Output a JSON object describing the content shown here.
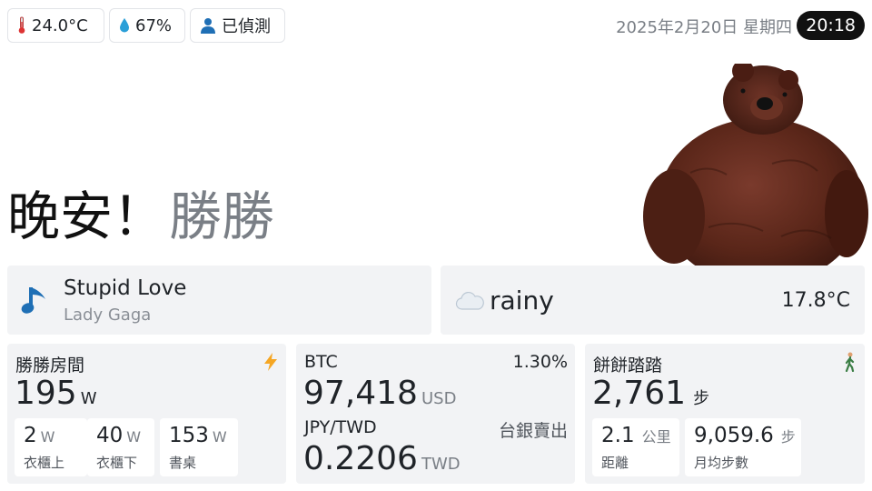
{
  "status": {
    "temperature": "24.0°C",
    "humidity": "67%",
    "presence": "已偵測"
  },
  "header": {
    "date": "2025年2月20日 星期四",
    "time": "20:18"
  },
  "greeting": {
    "hello": "晚安！",
    "name": "勝勝"
  },
  "music": {
    "title": "Stupid Love",
    "artist": "Lady Gaga",
    "icon": "music-note-icon"
  },
  "weather": {
    "condition": "rainy",
    "temperature": "17.8°C",
    "icon": "cloud-icon"
  },
  "power": {
    "label": "勝勝房間",
    "value": "195",
    "unit": "W",
    "icon": "lightning-icon",
    "items": [
      {
        "value": "2",
        "unit": "W",
        "label": "衣櫃上"
      },
      {
        "value": "40",
        "unit": "W",
        "label": "衣櫃下"
      },
      {
        "value": "153",
        "unit": "W",
        "label": "書桌"
      }
    ]
  },
  "finance": {
    "btc_label": "BTC",
    "btc_change": "1.30%",
    "btc_value": "97,418",
    "btc_unit": "USD",
    "fx_label": "JPY/TWD",
    "fx_source": "台銀賣出",
    "fx_value": "0.2206",
    "fx_unit": "TWD"
  },
  "steps": {
    "label": "餅餅踏踏",
    "value": "2,761",
    "unit": "步",
    "icon": "walking-person-icon",
    "items": [
      {
        "value": "2.1",
        "unit": "公里",
        "label": "距離"
      },
      {
        "value": "9,059.6",
        "unit": "步",
        "label": "月均步數"
      }
    ]
  },
  "colors": {
    "accent_blue": "#1f6fb5",
    "lightning": "#f5a623",
    "card_bg": "#f2f3f5"
  }
}
